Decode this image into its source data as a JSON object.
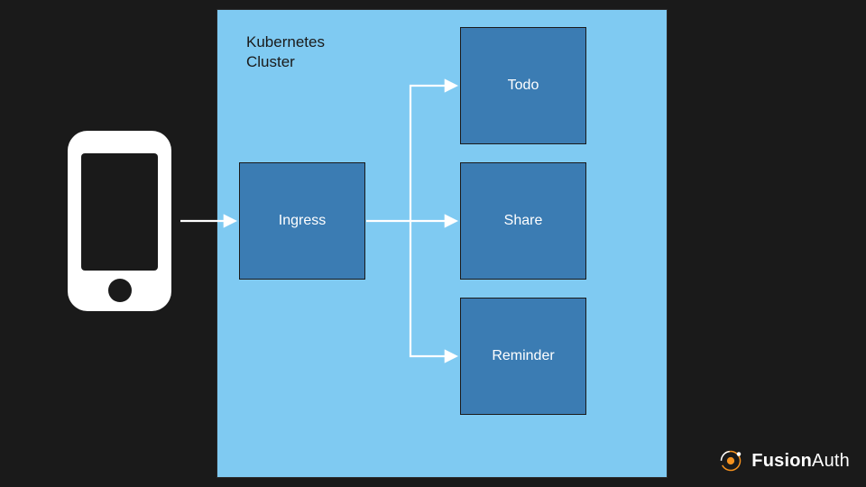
{
  "cluster": {
    "title": "Kubernetes\nCluster"
  },
  "boxes": {
    "ingress": "Ingress",
    "todo": "Todo",
    "share": "Share",
    "reminder": "Reminder"
  },
  "logo": {
    "brand_bold": "Fusion",
    "brand_rest": "Auth"
  },
  "icons": {
    "phone": "phone-icon",
    "logo_mark": "fusionauth-mark-icon"
  },
  "colors": {
    "cluster_bg": "#7fcaf2",
    "box_bg": "#3b7cb3",
    "accent": "#f6921e"
  }
}
